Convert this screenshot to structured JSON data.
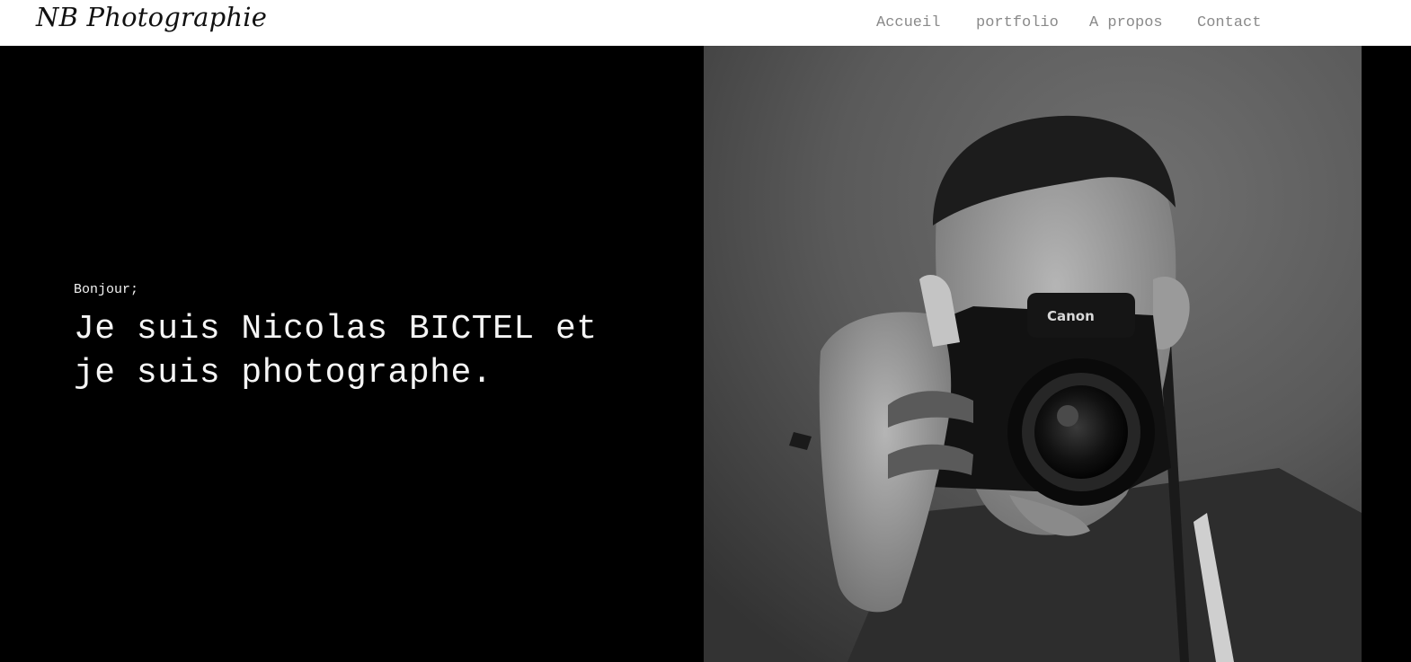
{
  "brand": {
    "logo_text": "NB Photographie"
  },
  "nav": {
    "items": [
      {
        "label": "Accueil"
      },
      {
        "label": "portfolio"
      },
      {
        "label": "A propos"
      },
      {
        "label": "Contact"
      }
    ]
  },
  "hero": {
    "greeting": "Bonjour;",
    "headline": "Je suis Nicolas BICTEL et je suis photographe.",
    "photo": {
      "camera_brand_text": "Canon",
      "style": "black-and-white"
    }
  },
  "colors": {
    "header_bg": "#ffffff",
    "page_bg": "#000000",
    "nav_text": "#8a8a8a",
    "hero_text": "#f5f5f5"
  }
}
